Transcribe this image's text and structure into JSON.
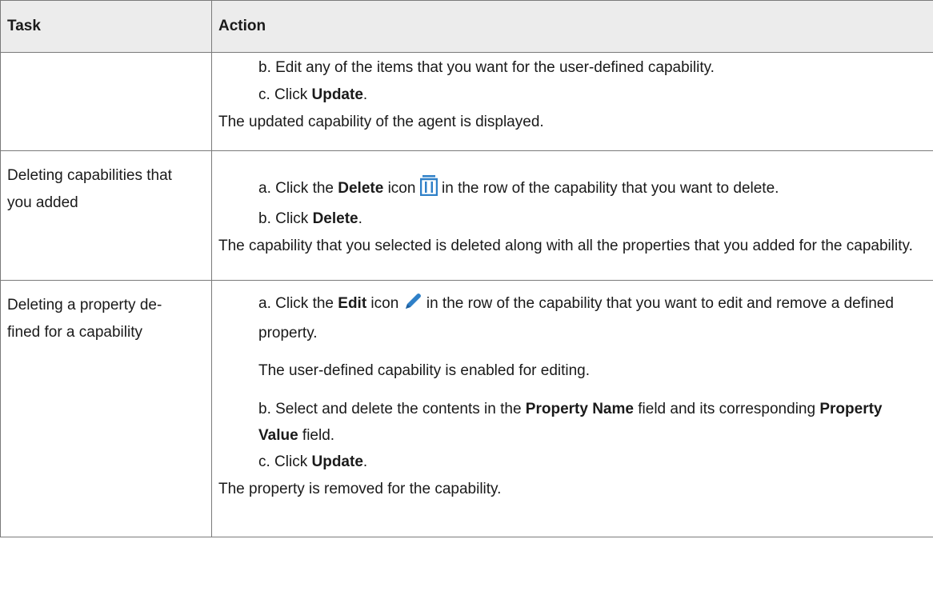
{
  "header": {
    "task": "Task",
    "action": "Action"
  },
  "rows": [
    {
      "task": "",
      "lines": {
        "b_text": "b. Edit any of the items that you want for the user-defined capability.",
        "c_pre": "c. Click ",
        "c_bold": "Update",
        "c_post": ".",
        "result": "The updated capability of the agent is displayed."
      }
    },
    {
      "task": "Deleting capabilities that you added",
      "lines": {
        "a_pre": "a. Click the ",
        "a_bold": "Delete",
        "a_mid": " icon ",
        "a_post": " in the row of the capability that you want to delete.",
        "b_pre": "b. Click ",
        "b_bold": "Delete",
        "b_post": ".",
        "result": "The capability that you selected is deleted along with all the properties that you added for the capability."
      }
    },
    {
      "task": "Deleting a property de­fined for a capability",
      "lines": {
        "a_pre": "a. Click the ",
        "a_bold": "Edit",
        "a_mid": " icon ",
        "a_post": " in the row of the capability that you want to edit and remove a defined property.",
        "a_note": "The user-defined capability is enabled for editing.",
        "b_pre": "b. Select and delete the contents in the ",
        "b_bold1": "Property Name",
        "b_mid": " field and its corre­sponding ",
        "b_bold2": "Property Value",
        "b_post": " field.",
        "c_pre": "c. Click ",
        "c_bold": "Update",
        "c_post": ".",
        "result": "The property is removed for the capability."
      }
    }
  ],
  "icons": {
    "delete": "trash-icon",
    "edit": "pencil-icon"
  },
  "colors": {
    "icon_blue": "#2f80c8",
    "border": "#7a7a7a",
    "header_bg": "#ececec"
  }
}
